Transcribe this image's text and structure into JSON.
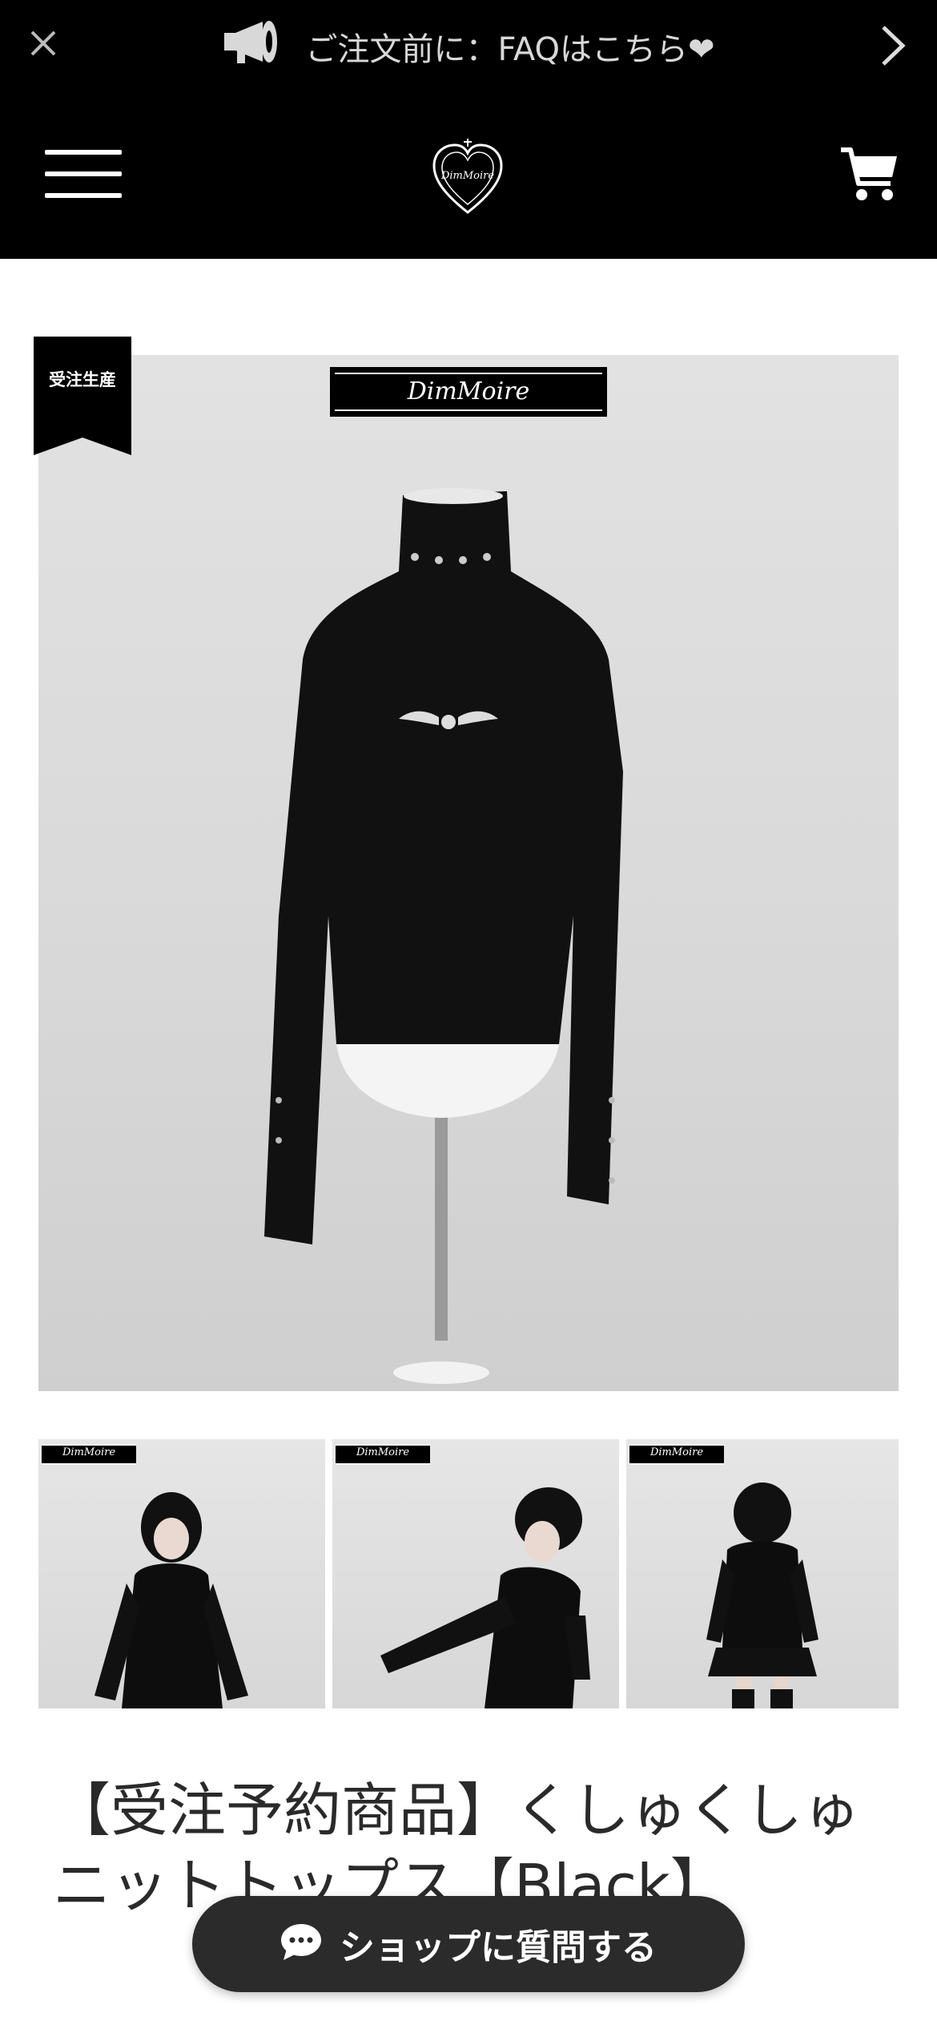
{
  "announcement": {
    "text": "ご注文前に：FAQはこちら❤",
    "close_icon": "close-icon",
    "megaphone_icon": "megaphone-icon",
    "next_icon": "chevron-right-icon"
  },
  "header": {
    "menu_icon": "hamburger-menu-icon",
    "logo": "DimMoire",
    "cart_icon": "cart-icon"
  },
  "product": {
    "badge": "受注生産",
    "image_brand": "DimMoire",
    "thumbnails": [
      {
        "brand": "DimMoire"
      },
      {
        "brand": "DimMoire"
      },
      {
        "brand": "DimMoire"
      }
    ],
    "title": "【受注予約商品】くしゅくしゅニットトップス【Black】"
  },
  "chat_button": {
    "label": "ショップに質問する",
    "icon": "chat-bubble-icon"
  },
  "colors": {
    "header_bg": "#000000",
    "chat_button_bg": "#2b2b2b"
  }
}
